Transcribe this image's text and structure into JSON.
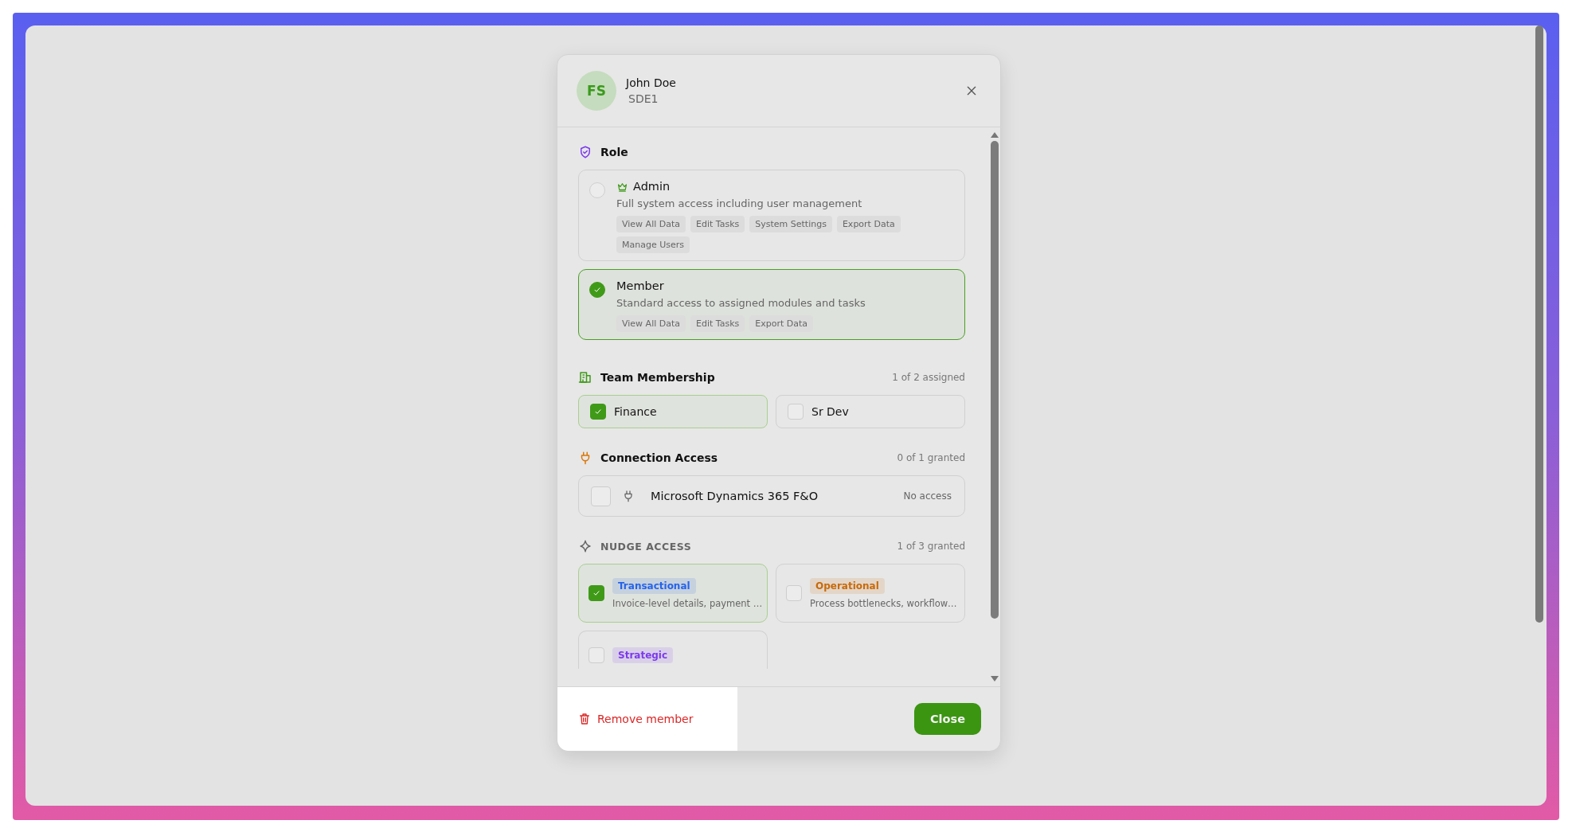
{
  "member": {
    "initials": "FS",
    "name": "John Doe",
    "title": "SDE1"
  },
  "role": {
    "title": "Role",
    "options": [
      {
        "name": "Admin",
        "kind": "admin",
        "selected": false,
        "description": "Full system access including user management",
        "permissions": [
          "View All Data",
          "Edit Tasks",
          "System Settings",
          "Export Data",
          "Manage Users"
        ]
      },
      {
        "name": "Member",
        "kind": "plain",
        "selected": true,
        "description": "Standard access to assigned modules and tasks",
        "permissions": [
          "View All Data",
          "Edit Tasks",
          "Export Data"
        ]
      }
    ]
  },
  "teams": {
    "title": "Team Membership",
    "count": "1 of 2 assigned",
    "items": [
      {
        "name": "Finance",
        "checked": true
      },
      {
        "name": "Sr Dev",
        "checked": false
      }
    ]
  },
  "connections": {
    "title": "Connection Access",
    "count": "0 of 1 granted",
    "items": [
      {
        "name": "Microsoft Dynamics 365 F&O",
        "checked": false,
        "status": "No access"
      }
    ]
  },
  "nudges": {
    "title": "NUDGE ACCESS",
    "count": "1 of 3 granted",
    "items": [
      {
        "name": "Transactional",
        "checked": true,
        "color": "#2563eb",
        "description": "Invoice-level details, payment …"
      },
      {
        "name": "Operational",
        "checked": false,
        "color": "#c86a0a",
        "description": "Process bottlenecks, workflow…"
      },
      {
        "name": "Strategic",
        "checked": false,
        "color": "#7c3aed"
      }
    ]
  },
  "footer": {
    "remove": "Remove member",
    "close": "Close"
  }
}
